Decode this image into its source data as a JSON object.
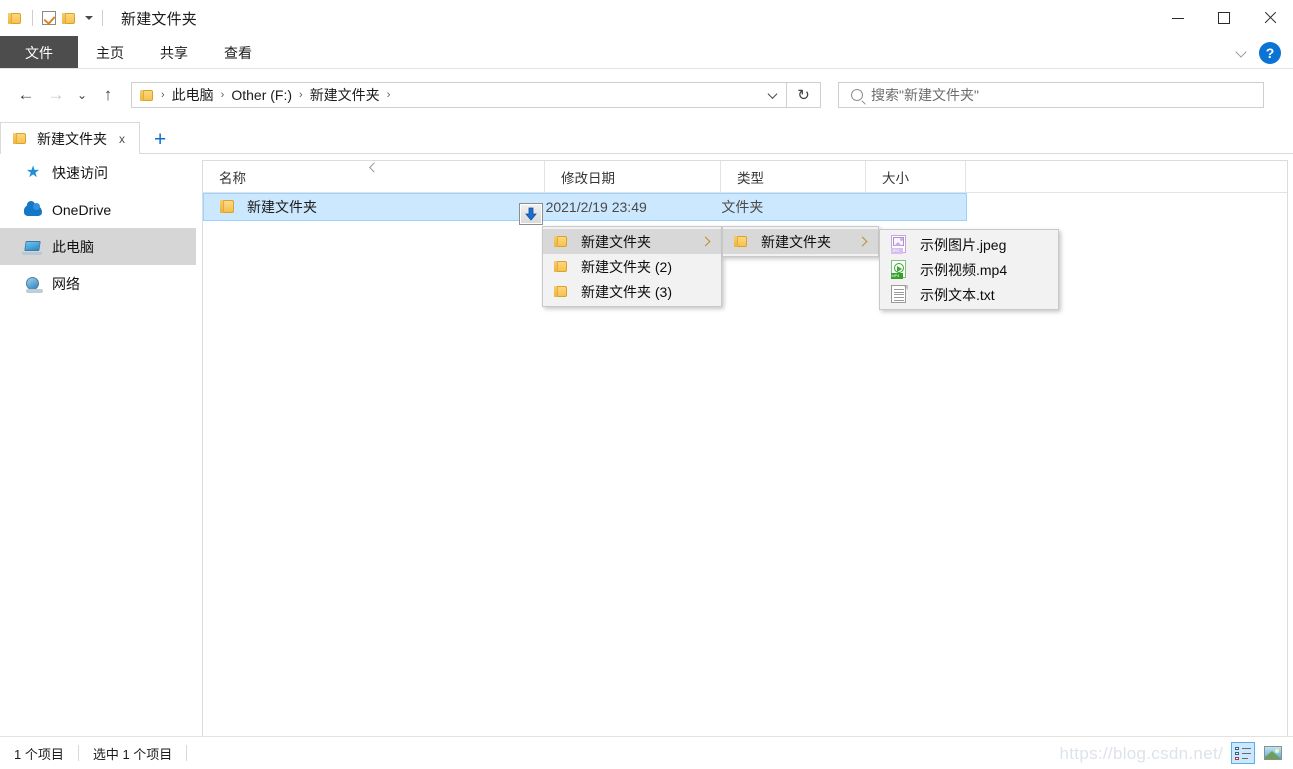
{
  "window": {
    "title": "新建文件夹",
    "quick_access_icons": [
      "folder-icon",
      "checkbox-icon",
      "folder-icon"
    ],
    "minimize_label": "",
    "maximize_label": "",
    "close_label": "",
    "help_label": "?"
  },
  "ribbon": {
    "tabs": [
      {
        "label": "文件",
        "active": true
      },
      {
        "label": "主页",
        "active": false
      },
      {
        "label": "共享",
        "active": false
      },
      {
        "label": "查看",
        "active": false
      }
    ]
  },
  "navigation": {
    "back_glyph": "←",
    "forward_glyph": "→",
    "recent_glyph": "⌄",
    "up_glyph": "↑",
    "refresh_glyph": "↻",
    "breadcrumbs": [
      "此电脑",
      "Other (F:)",
      "新建文件夹"
    ],
    "separator": "›"
  },
  "search": {
    "placeholder": "搜索\"新建文件夹\"",
    "icon": "search-icon"
  },
  "tabstrip": {
    "tabs": [
      {
        "label": "新建文件夹",
        "close": "x"
      }
    ],
    "new_tab": "+"
  },
  "sidebar": {
    "items": [
      {
        "label": "快速访问",
        "icon": "star-icon",
        "selected": false
      },
      {
        "label": "OneDrive",
        "icon": "cloud-icon",
        "selected": false
      },
      {
        "label": "此电脑",
        "icon": "monitor-icon",
        "selected": true
      },
      {
        "label": "网络",
        "icon": "globe-icon",
        "selected": false
      }
    ]
  },
  "filelist": {
    "columns": [
      {
        "label": "名称",
        "sort": "asc"
      },
      {
        "label": "修改日期",
        "sort": ""
      },
      {
        "label": "类型",
        "sort": ""
      },
      {
        "label": "大小",
        "sort": ""
      }
    ],
    "rows": [
      {
        "name": "新建文件夹",
        "date": "2021/2/19 23:49",
        "type": "文件夹",
        "size": "",
        "icon": "folder-icon",
        "selected": true
      }
    ]
  },
  "menus": {
    "menu1": {
      "items": [
        {
          "label": "新建文件夹",
          "icon": "folder-icon",
          "has_submenu": true,
          "highlighted": true
        },
        {
          "label": "新建文件夹 (2)",
          "icon": "folder-icon",
          "has_submenu": false,
          "highlighted": false
        },
        {
          "label": "新建文件夹 (3)",
          "icon": "folder-icon",
          "has_submenu": false,
          "highlighted": false
        }
      ]
    },
    "menu2": {
      "items": [
        {
          "label": "新建文件夹",
          "icon": "folder-icon",
          "has_submenu": true,
          "highlighted": true
        }
      ]
    },
    "menu3": {
      "items": [
        {
          "label": "示例图片.jpeg",
          "icon": "image-file-icon",
          "has_submenu": false,
          "highlighted": false
        },
        {
          "label": "示例视频.mp4",
          "icon": "video-file-icon",
          "has_submenu": false,
          "highlighted": false
        },
        {
          "label": "示例文本.txt",
          "icon": "text-file-icon",
          "has_submenu": false,
          "highlighted": false
        }
      ]
    }
  },
  "statusbar": {
    "item_count": "1 个项目",
    "selection": "选中 1 个项目",
    "views": [
      {
        "name": "details-view",
        "active": true
      },
      {
        "name": "large-icons-view",
        "active": false
      }
    ]
  },
  "watermark": "https://blog.csdn.net/",
  "colors": {
    "accent": "#0b6fd4",
    "selection": "#cce8ff",
    "file_tab_active": "#4d4d4d",
    "folder": "#f6bf45"
  }
}
